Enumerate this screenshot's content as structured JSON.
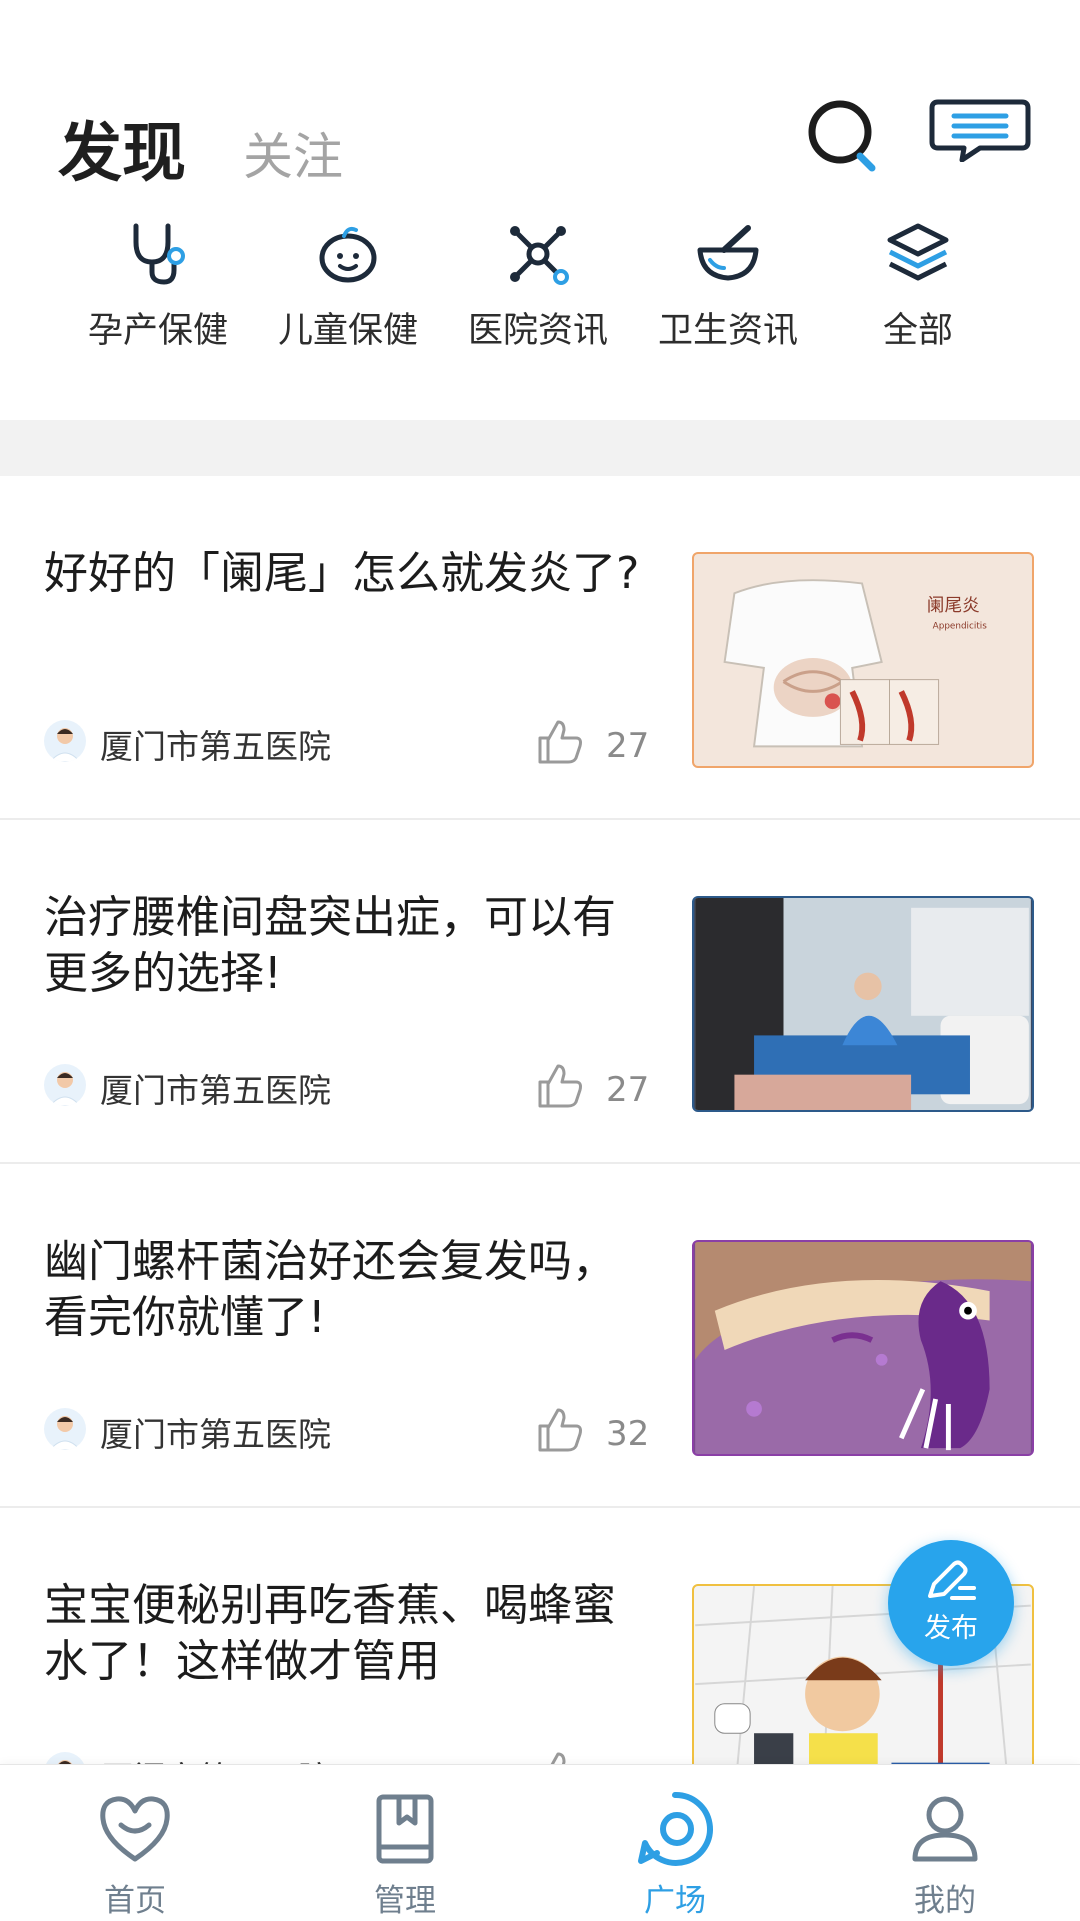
{
  "header": {
    "tabs": [
      {
        "label": "发现",
        "active": true
      },
      {
        "label": "关注",
        "active": false
      }
    ],
    "icons": [
      "search-icon",
      "message-icon"
    ]
  },
  "categories": [
    {
      "label": "孕产保健",
      "icon": "stethoscope-icon"
    },
    {
      "label": "儿童保健",
      "icon": "baby-face-icon"
    },
    {
      "label": "医院资讯",
      "icon": "network-icon"
    },
    {
      "label": "卫生资讯",
      "icon": "mortar-pestle-icon"
    },
    {
      "label": "全部",
      "icon": "layers-icon"
    }
  ],
  "feed": [
    {
      "title": "好好的「阑尾」怎么就发炎了?",
      "source": "厦门市第五医院",
      "likes": "27",
      "image_text": "阑尾炎",
      "image_subtext": "Appendicitis"
    },
    {
      "title": "治疗腰椎间盘突出症，可以有更多的选择!",
      "source": "厦门市第五医院",
      "likes": "27"
    },
    {
      "title": "幽门螺杆菌治好还会复发吗，看完你就懂了!",
      "source": "厦门市第五医院",
      "likes": "32"
    },
    {
      "title": "宝宝便秘别再吃香蕉、喝蜂蜜水了！这样做才管用",
      "source": "厦门市第五医院",
      "likes": ""
    }
  ],
  "fab": {
    "label": "发布"
  },
  "bottom_nav": [
    {
      "label": "首页",
      "icon": "heart-home-icon",
      "active": false
    },
    {
      "label": "管理",
      "icon": "book-icon",
      "active": false
    },
    {
      "label": "广场",
      "icon": "plaza-icon",
      "active": true
    },
    {
      "label": "我的",
      "icon": "person-icon",
      "active": false
    }
  ],
  "colors": {
    "accent": "#2e9fe4",
    "icon_dark": "#1d2a3a",
    "divider": "#f2f2f2"
  }
}
